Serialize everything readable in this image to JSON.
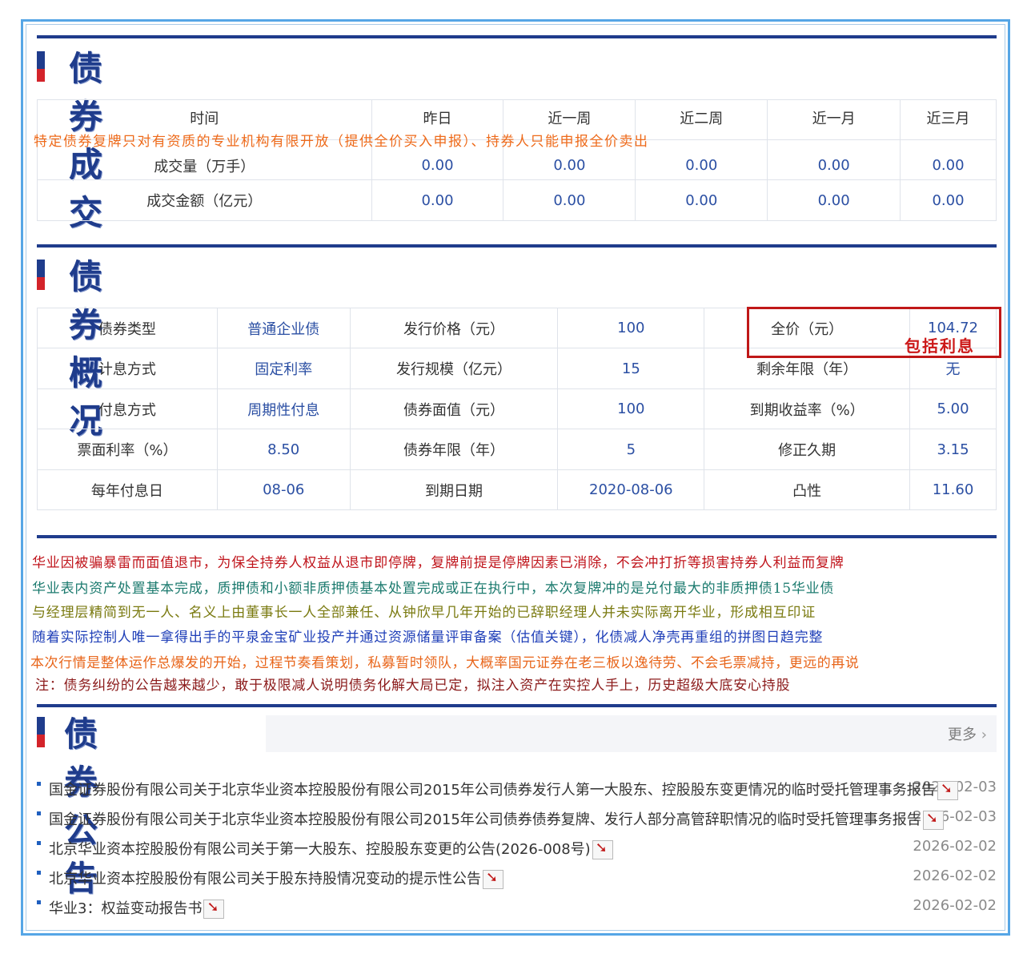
{
  "sections": {
    "trade_title": "债券成交",
    "overview_title": "债券概况",
    "announce_title": "债券公告"
  },
  "trade": {
    "headers": [
      "时间",
      "昨日",
      "近一周",
      "近二周",
      "近一月",
      "近三月"
    ],
    "notice": "特定债券复牌只对有资质的专业机构有限开放（提供全价买入申报）、持券人只能申报全价卖出",
    "rows": [
      {
        "label": "成交量（万手）",
        "values": [
          "0.00",
          "0.00",
          "0.00",
          "0.00",
          "0.00"
        ]
      },
      {
        "label": "成交金额（亿元）",
        "values": [
          "0.00",
          "0.00",
          "0.00",
          "0.00",
          "0.00"
        ]
      }
    ]
  },
  "overview": {
    "rows": [
      [
        "债券类型",
        "普通企业债",
        "发行价格（元）",
        "100",
        "全价（元）",
        "104.72"
      ],
      [
        "计息方式",
        "固定利率",
        "发行规模（亿元）",
        "15",
        "剩余年限（年）",
        "无"
      ],
      [
        "付息方式",
        "周期性付息",
        "债券面值（元）",
        "100",
        "到期收益率（%）",
        "5.00"
      ],
      [
        "票面利率（%）",
        "8.50",
        "债券年限（年）",
        "5",
        "修正久期",
        "3.15"
      ],
      [
        "每年付息日",
        "08-06",
        "到期日期",
        "2020-08-06",
        "凸性",
        "11.60"
      ]
    ],
    "highlight_note": "包括利息"
  },
  "comments": [
    {
      "text": "华业因被骗暴雷而面值退市，为保全持券人权益从退市即停牌，复牌前提是停牌因素已消除，不会冲打折等损害持券人利益而复牌",
      "color": "#c0151c"
    },
    {
      "text": "华业表内资产处置基本完成，质押债和小额非质押债基本处置完成或正在执行中，本次复牌冲的是兑付最大的非质押债15华业债",
      "color": "#1b7a6e"
    },
    {
      "text": "与经理层精简到无一人、名义上由董事长一人全部兼任、从钟欣早几年开始的已辞职经理人并未实际离开华业，形成相互印证",
      "color": "#7a7a10"
    },
    {
      "text": "随着实际控制人唯一拿得出手的平泉金宝矿业投产并通过资源储量评审备案（估值关键），化债减人净壳再重组的拼图日趋完整",
      "color": "#1f3fb8"
    },
    {
      "text": "本次行情是整体运作总爆发的开始，过程节奏看策划，私募暂时领队，大概率国元证券在老三板以逸待劳、不会毛票减持，更远的再说",
      "color": "#e8651a"
    },
    {
      "text": "注：债务纠纷的公告越来越少，敢于极限减人说明债务化解大局已定，拟注入资产在实控人手上，历史超级大底安心持股",
      "color": "#8b1a1a"
    }
  ],
  "announcements": {
    "more_label": "更多",
    "items": [
      {
        "title": "国金证券股份有限公司关于北京华业资本控股股份有限公司2015年公司债券发行人第一大股东、控股股东变更情况的临时受托管理事务报告",
        "date": "2026-02-03"
      },
      {
        "title": "国金证券股份有限公司关于北京华业资本控股股份有限公司2015年公司债券债券复牌、发行人部分高管辞职情况的临时受托管理事务报告",
        "date": "2026-02-03"
      },
      {
        "title": "北京华业资本控股股份有限公司关于第一大股东、控股股东变更的公告(2026-008号)",
        "date": "2026-02-02"
      },
      {
        "title": "北京华业资本控股股份有限公司关于股东持股情况变动的提示性公告",
        "date": "2026-02-02"
      },
      {
        "title": "华业3：权益变动报告书",
        "date": "2026-02-02"
      }
    ]
  },
  "colors": {
    "brand_navy": "#1f3c8c",
    "accent_red": "#d3232a",
    "frame_blue": "#56a6e6",
    "value_blue": "#2b4fa3"
  }
}
